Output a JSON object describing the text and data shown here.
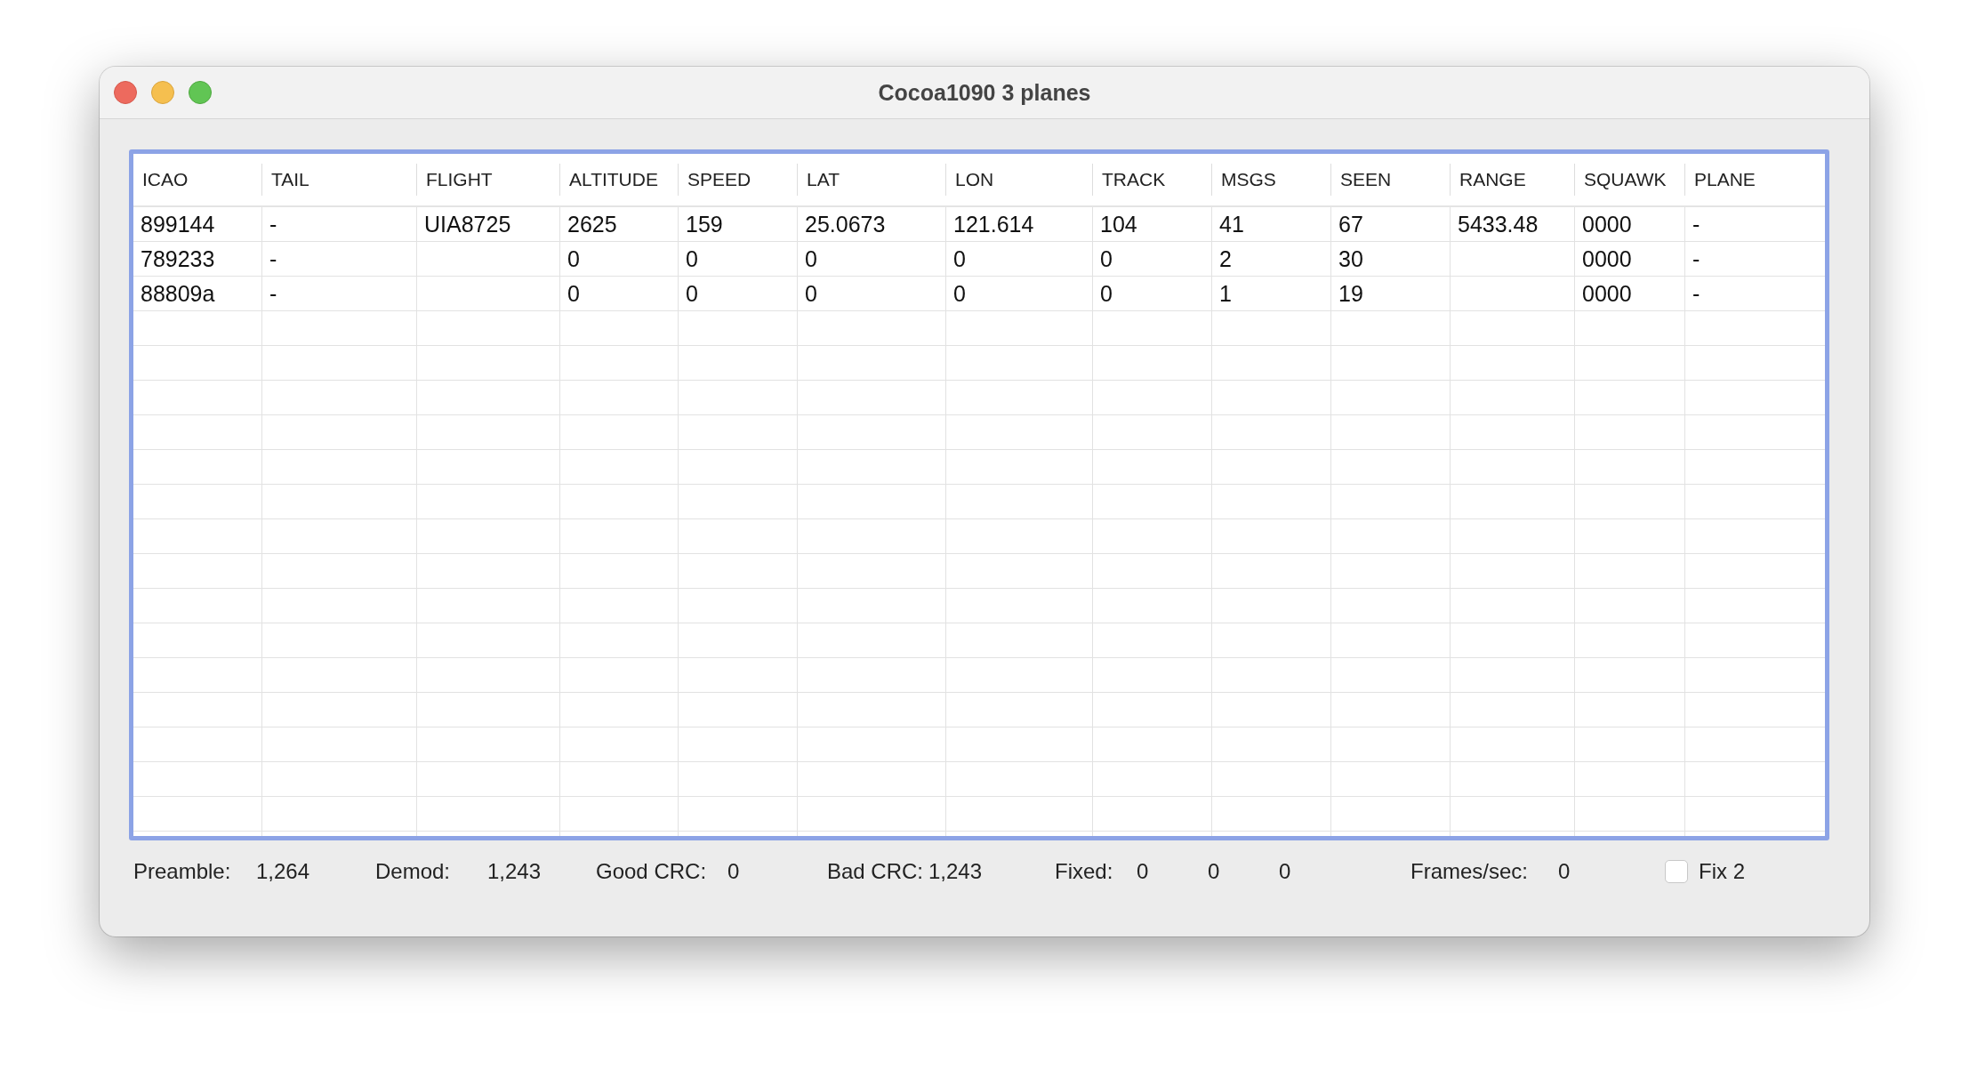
{
  "window": {
    "title": "Cocoa1090 3 planes"
  },
  "table": {
    "columns": [
      "ICAO",
      "TAIL",
      "FLIGHT",
      "ALTITUDE",
      "SPEED",
      "LAT",
      "LON",
      "TRACK",
      "MSGS",
      "SEEN",
      "RANGE",
      "SQUAWK",
      "PLANE"
    ],
    "rows": [
      [
        "899144",
        "-",
        "UIA8725",
        "2625",
        "159",
        "25.0673",
        "121.614",
        "104",
        "41",
        "67",
        "5433.48",
        "0000",
        "-"
      ],
      [
        "789233",
        "-",
        "",
        "0",
        "0",
        "0",
        "0",
        "0",
        "2",
        "30",
        "",
        "0000",
        "-"
      ],
      [
        "88809a",
        "-",
        "",
        "0",
        "0",
        "0",
        "0",
        "0",
        "1",
        "19",
        "",
        "0000",
        "-"
      ]
    ]
  },
  "status_bar": {
    "fields": [
      {
        "label": "Preamble:",
        "values": [
          "1,264"
        ]
      },
      {
        "label": "Demod:",
        "values": [
          "1,243"
        ]
      },
      {
        "label": "Good CRC:",
        "values": [
          "0"
        ]
      },
      {
        "label": "Bad CRC:",
        "values": [
          "1,243"
        ]
      },
      {
        "label": "Fixed:",
        "values": [
          "0",
          "0",
          "0"
        ]
      },
      {
        "label": "Frames/sec:",
        "values": [
          "0"
        ]
      }
    ],
    "fix_checkbox": {
      "label": "Fix 2",
      "checked": false
    }
  }
}
